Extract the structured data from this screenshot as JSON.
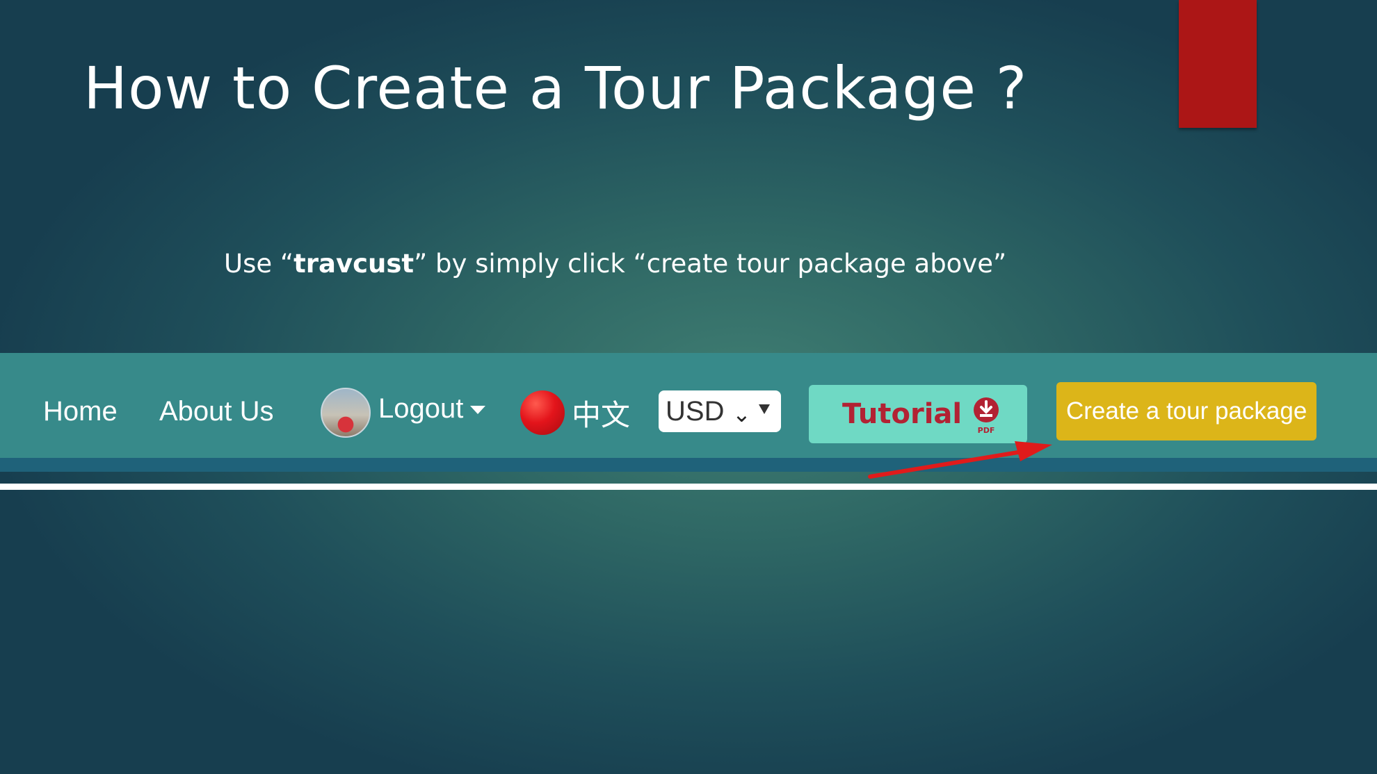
{
  "slide": {
    "title": "How to Create a Tour Package ?",
    "subtitle_prefix": "Use “",
    "subtitle_brand": "travcust",
    "subtitle_suffix": "” by simply click “create tour package above”"
  },
  "navbar": {
    "home_label": "Home",
    "about_label": "About Us",
    "logout_label": "Logout",
    "language_label": "中文",
    "currency_value": "USD",
    "tutorial_label": "Tutorial",
    "pdf_label": "PDF",
    "create_package_label": "Create a tour package"
  },
  "colors": {
    "accent_tab": "#ac1616",
    "navbar_bg": "#378a8a",
    "tutorial_button": "#6fd9c4",
    "tutorial_text": "#b22233",
    "create_button": "#dcb519",
    "arrow": "#e01b1b"
  },
  "icons": [
    "user-avatar",
    "caret-down-icon",
    "china-flag-icon",
    "dropdown-arrow-icon",
    "pdf-download-icon",
    "red-arrow-annotation"
  ]
}
